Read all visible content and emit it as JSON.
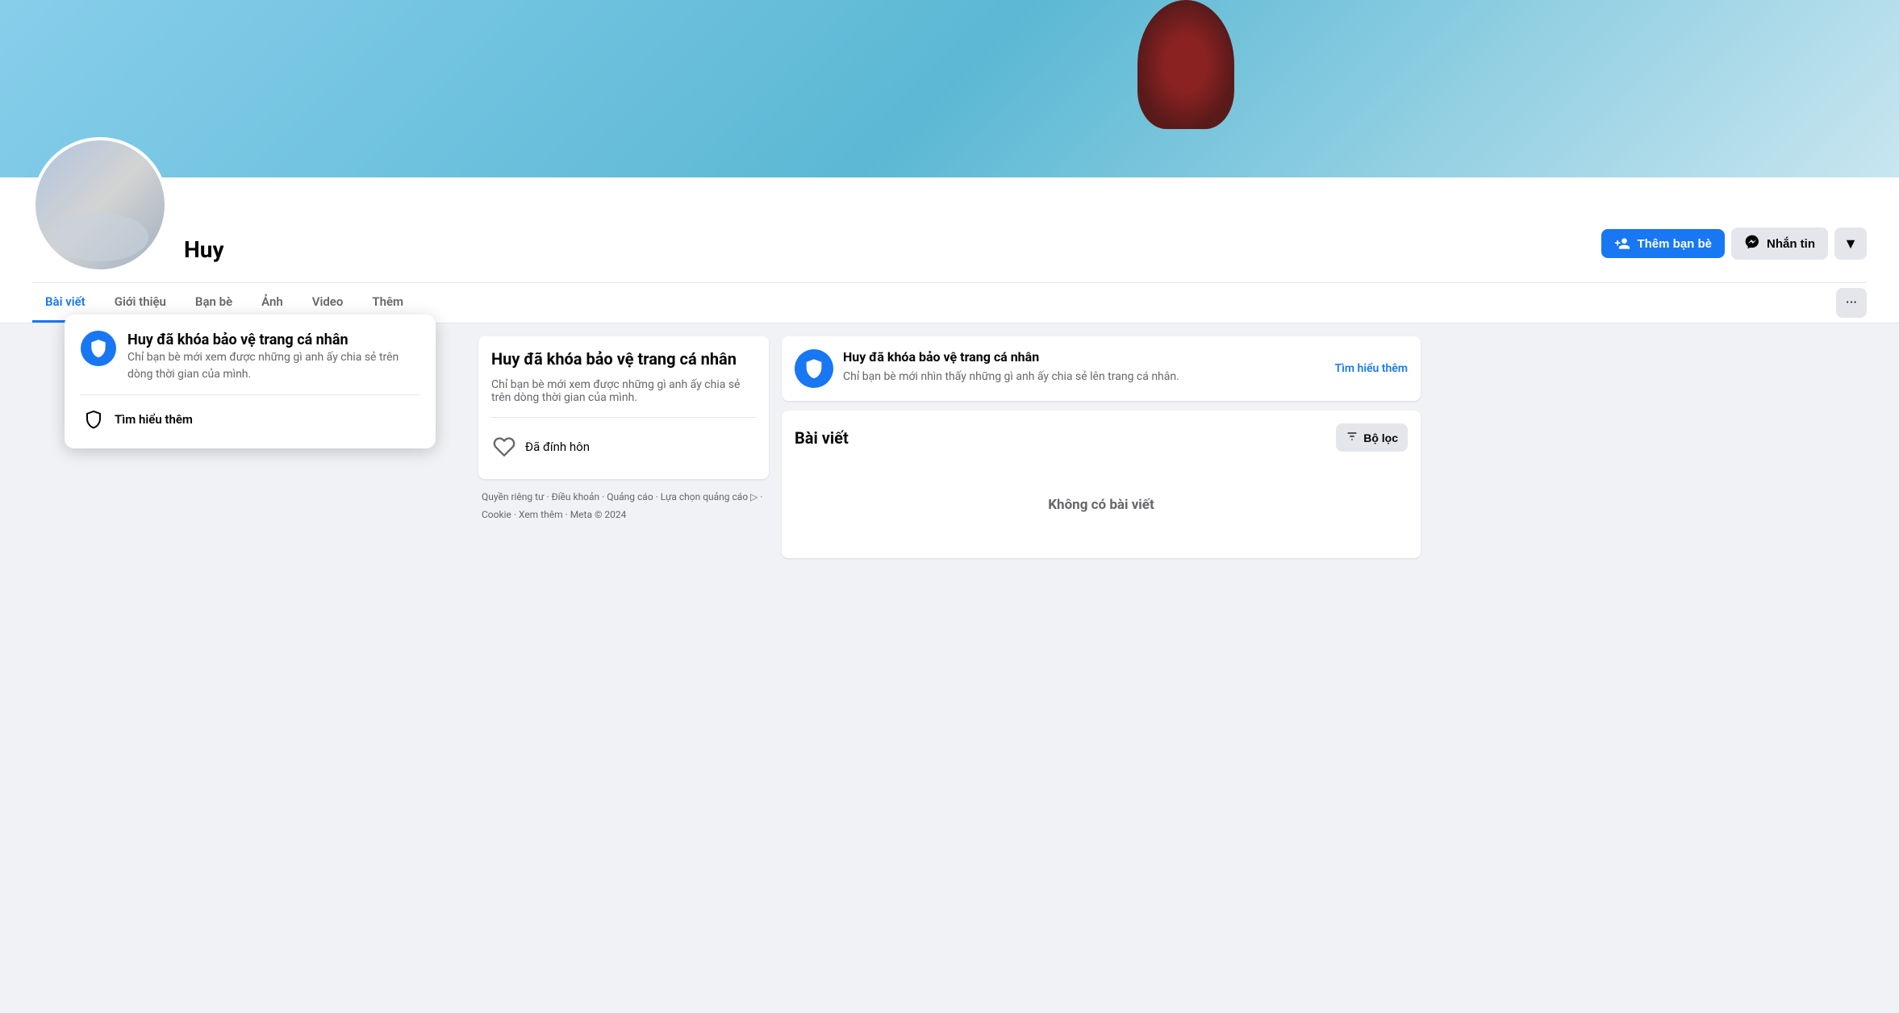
{
  "cover": {
    "alt": "Cover photo"
  },
  "profile": {
    "name": "Huy",
    "friends_count": "",
    "avatar_alt": "Profile photo"
  },
  "actions": {
    "add_friend": "Thêm bạn bè",
    "message": "Nhắn tin",
    "more_icon": "▼"
  },
  "nav": {
    "tabs": [
      "Bài viết",
      "Giới thiệu",
      "Bạn bè",
      "Ảnh",
      "Video",
      "Thêm"
    ],
    "active": "Bài viết",
    "more_options": "···"
  },
  "tooltip": {
    "title": "Huy đã khóa bảo vệ trang cá nhân",
    "description": "Chỉ bạn bè mới xem được những gì anh ấy chia sẻ trên dòng thời gian của mình.",
    "learn_more": "Tìm hiểu thêm"
  },
  "left_col": {
    "privacy_notice": {
      "title": "Huy đã khóa bảo vệ trang cá nhân",
      "description": "Chỉ bạn bè mới xem được những gì anh ấy chia sẻ trên dòng thời gian của mình."
    },
    "relationship": {
      "status": "Đã đính hôn"
    }
  },
  "right_col": {
    "protection": {
      "title": "Huy đã khóa bảo vệ trang cá nhân",
      "description": "Chỉ bạn bè mới nhìn thấy những gì anh ấy chia sẻ lên trang cá nhân.",
      "learn_more": "Tìm hiểu thêm"
    },
    "posts": {
      "title": "Bài viết",
      "filter_label": "Bộ lọc",
      "empty_message": "Không có bài viết"
    }
  },
  "footer": {
    "links": "Quyền riêng tư · Điều khoản · Quảng cáo · Lựa chọn quảng cáo · Cookie · Xem thêm · Meta © 2024",
    "line1": "Quyền riêng tư · Điều khoản · Quảng cáo · Lựa chọn quảng cáo ▷ ·",
    "line2": "Cookie · Xem thêm · Meta © 2024"
  }
}
